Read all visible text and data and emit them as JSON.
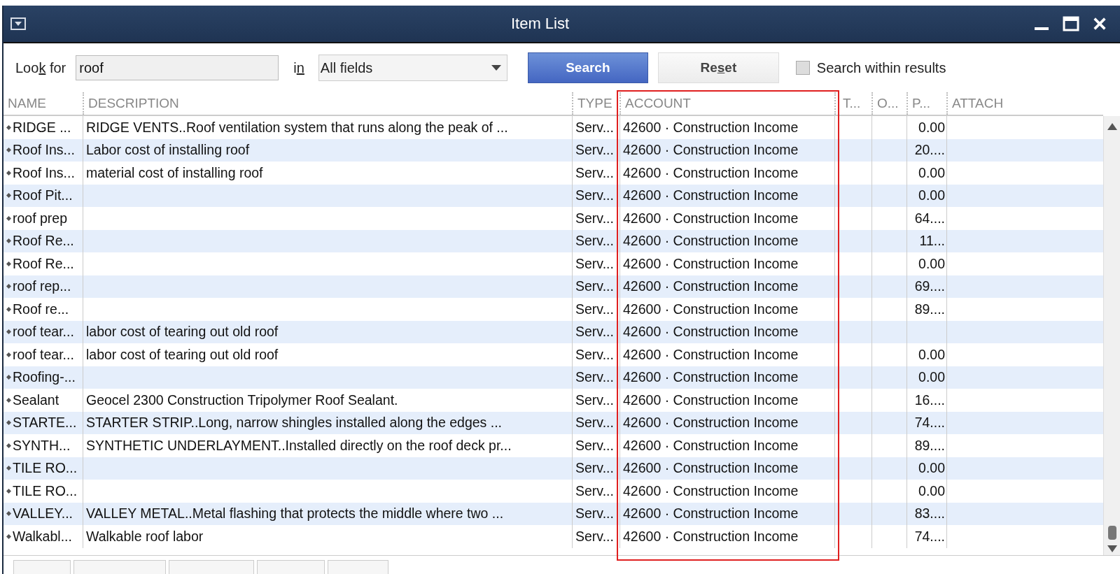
{
  "window": {
    "title": "Item List"
  },
  "search_bar": {
    "look_for_label": {
      "before": "Loo",
      "key": "k",
      "after": " for"
    },
    "look_for_value": "roof",
    "in_label": {
      "before": "i",
      "key": "n"
    },
    "field_select": "All fields",
    "search_button": "Search",
    "reset_button": {
      "before": "Re",
      "key": "s",
      "after": "et"
    },
    "within_results": {
      "label": "Search within results",
      "checked": false
    }
  },
  "table": {
    "columns": [
      "NAME",
      "DESCRIPTION",
      "TYPE",
      "ACCOUNT",
      "T...",
      "O...",
      "P...",
      "ATTACH"
    ],
    "rows": [
      {
        "name": "RIDGE ...",
        "description": "RIDGE VENTS..Roof ventilation system that runs along the peak of ...",
        "type": "Serv...",
        "account": "42600 · Construction Income",
        "price": "0.00"
      },
      {
        "name": "Roof Ins...",
        "description": "Labor cost of installing roof",
        "type": "Serv...",
        "account": "42600 · Construction Income",
        "price": "20...."
      },
      {
        "name": "Roof Ins...",
        "description": "material cost of installing roof",
        "type": "Serv...",
        "account": "42600 · Construction Income",
        "price": "0.00"
      },
      {
        "name": "Roof Pit...",
        "description": "",
        "type": "Serv...",
        "account": "42600 · Construction Income",
        "price": "0.00"
      },
      {
        "name": "roof prep",
        "description": "",
        "type": "Serv...",
        "account": "42600 · Construction Income",
        "price": "64...."
      },
      {
        "name": "Roof Re...",
        "description": "",
        "type": "Serv...",
        "account": "42600 · Construction Income",
        "price": "11..."
      },
      {
        "name": "Roof Re...",
        "description": "",
        "type": "Serv...",
        "account": "42600 · Construction Income",
        "price": "0.00"
      },
      {
        "name": "roof rep...",
        "description": "",
        "type": "Serv...",
        "account": "42600 · Construction Income",
        "price": "69...."
      },
      {
        "name": "Roof re...",
        "description": "",
        "type": "Serv...",
        "account": "42600 · Construction Income",
        "price": "89...."
      },
      {
        "name": "roof tear...",
        "description": "labor cost of tearing out old roof",
        "type": "Serv...",
        "account": "42600 · Construction Income",
        "price": ""
      },
      {
        "name": "roof tear...",
        "description": "labor cost of tearing out old roof",
        "type": "Serv...",
        "account": "42600 · Construction Income",
        "price": "0.00"
      },
      {
        "name": "Roofing-...",
        "description": "",
        "type": "Serv...",
        "account": "42600 · Construction Income",
        "price": "0.00"
      },
      {
        "name": "Sealant",
        "description": "Geocel 2300 Construction Tripolymer Roof Sealant.",
        "type": "Serv...",
        "account": "42600 · Construction Income",
        "price": "16...."
      },
      {
        "name": "STARTE...",
        "description": "STARTER STRIP..Long, narrow shingles installed along the edges ...",
        "type": "Serv...",
        "account": "42600 · Construction Income",
        "price": "74...."
      },
      {
        "name": "SYNTH...",
        "description": "SYNTHETIC UNDERLAYMENT..Installed directly on the roof deck pr...",
        "type": "Serv...",
        "account": "42600 · Construction Income",
        "price": "89...."
      },
      {
        "name": "TILE RO...",
        "description": "",
        "type": "Serv...",
        "account": "42600 · Construction Income",
        "price": "0.00"
      },
      {
        "name": "TILE RO...",
        "description": "",
        "type": "Serv...",
        "account": "42600 · Construction Income",
        "price": "0.00"
      },
      {
        "name": "VALLEY...",
        "description": "VALLEY METAL..Metal flashing that protects the middle where two ...",
        "type": "Serv...",
        "account": "42600 · Construction Income",
        "price": "83...."
      },
      {
        "name": "Walkabl...",
        "description": "Walkable roof labor",
        "type": "Serv...",
        "account": "42600 · Construction Income",
        "price": "74...."
      }
    ]
  }
}
